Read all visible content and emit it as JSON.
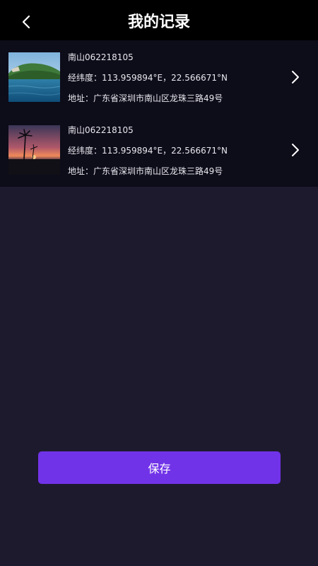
{
  "header": {
    "title": "我的记录",
    "back_icon": "chevron-left-icon"
  },
  "records": [
    {
      "name": "南山062218105",
      "coord": "经纬度：113.959894°E，22.566671°N",
      "address": "地址：广东省深圳市南山区龙珠三路49号",
      "thumbnail": "coastal-island-photo",
      "arrow_icon": "chevron-right-icon"
    },
    {
      "name": "南山062218105",
      "coord": "经纬度：113.959894°E，22.566671°N",
      "address": "地址：广东省深圳市南山区龙珠三路49号",
      "thumbnail": "palm-sunset-photo",
      "arrow_icon": "chevron-right-icon"
    }
  ],
  "footer": {
    "save_label": "保存"
  },
  "colors": {
    "background": "#1e1a2e",
    "header": "#000000",
    "list": "#0d0c19",
    "accent": "#7133e8"
  }
}
